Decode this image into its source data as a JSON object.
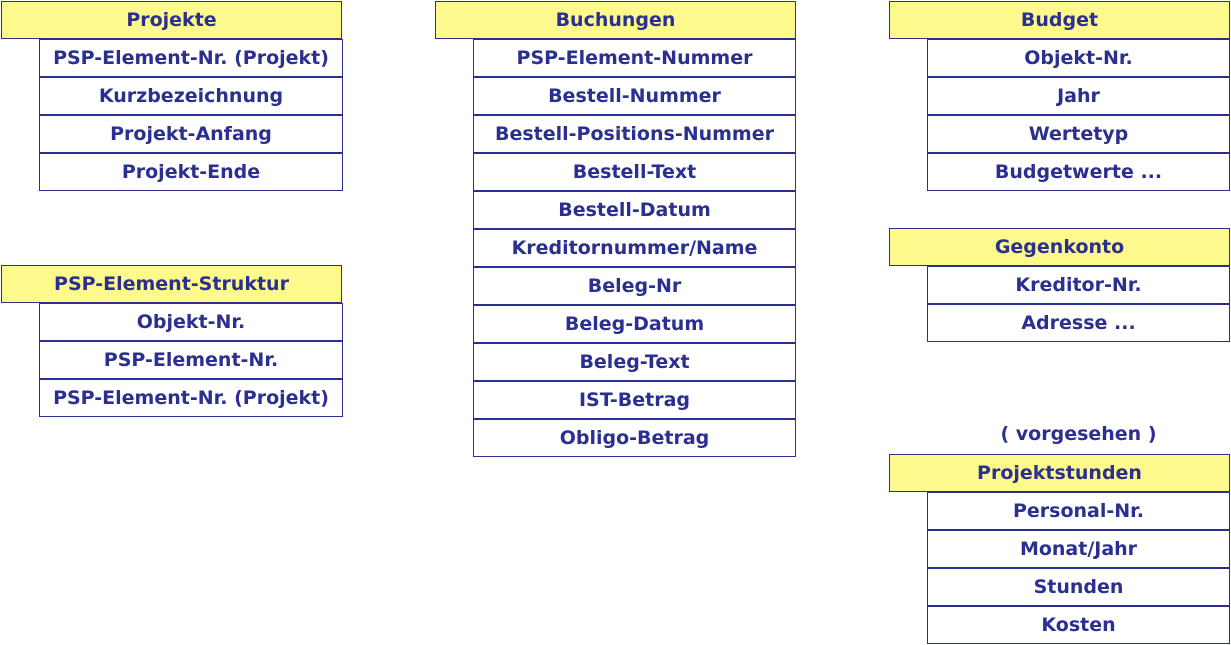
{
  "tables": {
    "projekte": {
      "title": "Projekte",
      "fields": [
        "PSP-Element-Nr. (Projekt)",
        "Kurzbezeichnung",
        "Projekt-Anfang",
        "Projekt-Ende"
      ]
    },
    "psp_struktur": {
      "title": "PSP-Element-Struktur",
      "fields": [
        "Objekt-Nr.",
        "PSP-Element-Nr.",
        "PSP-Element-Nr. (Projekt)"
      ]
    },
    "buchungen": {
      "title": "Buchungen",
      "fields": [
        "PSP-Element-Nummer",
        "Bestell-Nummer",
        "Bestell-Positions-Nummer",
        "Bestell-Text",
        "Bestell-Datum",
        "Kreditornummer/Name",
        "Beleg-Nr",
        "Beleg-Datum",
        "Beleg-Text",
        "IST-Betrag",
        "Obligo-Betrag"
      ]
    },
    "budget": {
      "title": "Budget",
      "fields": [
        "Objekt-Nr.",
        "Jahr",
        "Wertetyp",
        "Budgetwerte ..."
      ]
    },
    "gegenkonto": {
      "title": "Gegenkonto",
      "fields": [
        "Kreditor-Nr.",
        "Adresse ..."
      ]
    },
    "projektstunden": {
      "title": "Projektstunden",
      "note": "( vorgesehen )",
      "fields": [
        "Personal-Nr.",
        "Monat/Jahr",
        "Stunden",
        "Kosten"
      ]
    }
  },
  "colors": {
    "header_bg": "#fdf98c",
    "text": "#2b2f8f",
    "border": "#2b2f8f"
  }
}
